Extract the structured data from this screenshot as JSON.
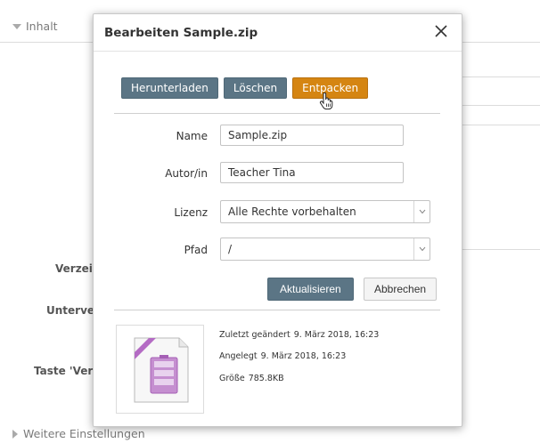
{
  "background": {
    "section_title": "Inhalt",
    "labels": [
      "Verzeichn",
      "Unterver",
      "Taste 'Ver"
    ],
    "footer_link": "Weitere Einstellungen"
  },
  "dialog": {
    "title": "Bearbeiten Sample.zip",
    "close_icon": "close-icon",
    "actions": {
      "download": "Herunterladen",
      "delete": "Löschen",
      "unzip": "Entpacken"
    },
    "form": {
      "name_label": "Name",
      "name_value": "Sample.zip",
      "author_label": "Autor/in",
      "author_value": "Teacher Tina",
      "license_label": "Lizenz",
      "license_value": "Alle Rechte vorbehalten",
      "path_label": "Pfad",
      "path_value": "/"
    },
    "update_button": "Aktualisieren",
    "cancel_button": "Abbrechen",
    "file_icon": "archive-file-icon",
    "meta": {
      "modified_label": "Zuletzt geändert",
      "modified_value": "9. März 2018, 16:23",
      "created_label": "Angelegt",
      "created_value": "9. März 2018, 16:23",
      "size_label": "Größe",
      "size_value": "785.8KB"
    }
  },
  "colors": {
    "slate_button": "#5b7585",
    "orange_button": "#d58512",
    "archive_purple": "#b46bc4"
  }
}
